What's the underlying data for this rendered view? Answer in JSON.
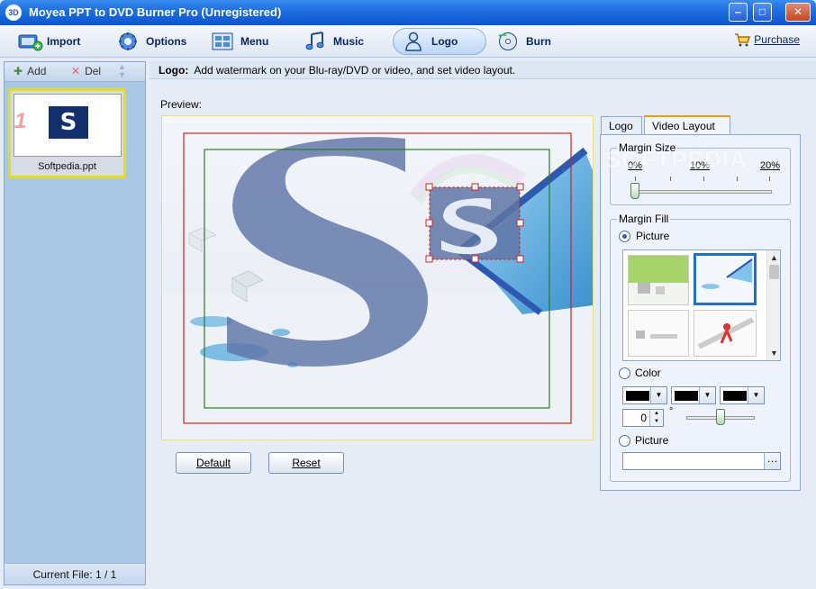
{
  "window": {
    "title": "Moyea PPT to DVD Burner Pro (Unregistered)",
    "app_icon": "3D",
    "minimize_glyph": "‒",
    "maximize_glyph": "□",
    "close_glyph": "✕"
  },
  "toolbar": {
    "import": "Import",
    "options": "Options",
    "menu": "Menu",
    "music": "Music",
    "logo": "Logo",
    "burn": "Burn",
    "purchase": "Purchase",
    "active": "Logo"
  },
  "sidebar": {
    "add": "Add",
    "del": "Del",
    "items": [
      {
        "number": "1",
        "slide_letter": "S",
        "filename": "Softpedia.ppt"
      }
    ],
    "footer": "Current File: 1 / 1"
  },
  "hint": {
    "label": "Logo:",
    "text": "Add watermark on your Blu-ray/DVD or video, and set video layout."
  },
  "preview": {
    "label": "Preview:"
  },
  "buttons": {
    "default": "Default",
    "reset": "Reset"
  },
  "panel": {
    "tabs": [
      "Logo",
      "Video Layout"
    ],
    "active_tab": "Video Layout",
    "margin_size": {
      "title": "Margin Size",
      "ticks": [
        "0%",
        "10%",
        "20%"
      ],
      "value_percent": 0
    },
    "margin_fill": {
      "title": "Margin Fill",
      "picture_option": "Picture",
      "color_option": "Color",
      "picture_option2": "Picture",
      "selected": "Picture",
      "rotation_value": "0",
      "degree_symbol": "°",
      "color_values": [
        "#000000",
        "#000000",
        "#000000"
      ]
    }
  },
  "watermark_text": "SOFTPEDIA"
}
